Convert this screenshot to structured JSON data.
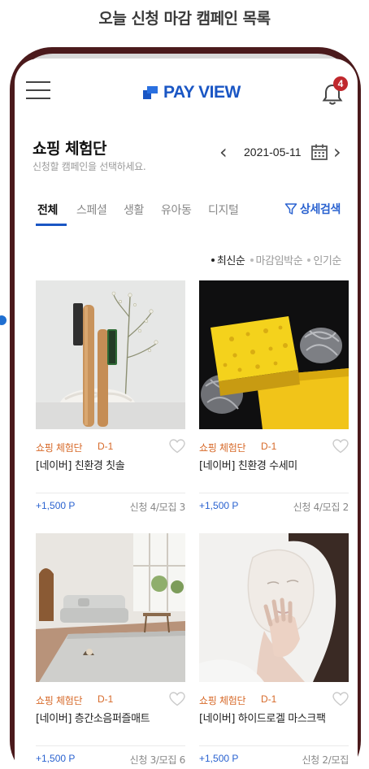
{
  "caption": "오늘 신청 마감 캠페인 목록",
  "header": {
    "logo_text": "PAY VIEW",
    "notification_count": "4"
  },
  "section": {
    "title": "쇼핑 체험단",
    "subtitle": "신청할 캠페인을 선택하세요.",
    "date": "2021-05-11",
    "prev_icon": "chevron-left-icon",
    "next_icon": "chevron-right-icon"
  },
  "tabs": [
    {
      "label": "전체",
      "active": true
    },
    {
      "label": "스페셜"
    },
    {
      "label": "생활"
    },
    {
      "label": "유아동"
    },
    {
      "label": "디지털"
    }
  ],
  "advanced_search": "상세검색",
  "sort_options": [
    {
      "label": "최신순",
      "active": true
    },
    {
      "label": "마감임박순"
    },
    {
      "label": "인기순"
    }
  ],
  "campaigns": [
    {
      "category": "쇼핑 체험단",
      "dday": "D-1",
      "name": "[네이버] 친환경 칫솔",
      "point": "+1,500 P",
      "count": "신청 4/모집 3",
      "image": "bamboo-toothbrush-photo"
    },
    {
      "category": "쇼핑 체험단",
      "dday": "D-1",
      "name": "[네이버] 친환경 수세미",
      "point": "+1,500 P",
      "count": "신청 4/모집 2",
      "image": "sponge-scrubber-photo"
    },
    {
      "category": "쇼핑 체험단",
      "dday": "D-1",
      "name": "[네이버] 층간소음퍼즐매트",
      "point": "+1,500 P",
      "count": "신청 3/모집 6",
      "image": "living-room-mat-photo"
    },
    {
      "category": "쇼핑 체험단",
      "dday": "D-1",
      "name": "[네이버] 하이드로겔 마스크팩",
      "point": "+1,500 P",
      "count": "신청 2/모집",
      "image": "face-mask-photo"
    }
  ],
  "colors": {
    "brand": "#1a56c4",
    "category": "#d76a2a",
    "point": "#2a62d0",
    "badge": "#c0282d",
    "frame": "#4b1a1c"
  }
}
